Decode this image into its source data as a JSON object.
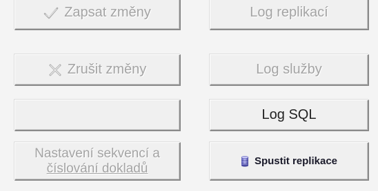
{
  "buttons": {
    "save": {
      "label": "Zapsat změny",
      "icon": "checkmark-icon",
      "enabled": false
    },
    "cancel": {
      "label": "Zrušit změny",
      "icon": "cross-icon",
      "enabled": false
    },
    "blank": {
      "label": ""
    },
    "sequences": {
      "line1": "Nastavení sekvencí a",
      "line2": "číslování dokladů",
      "enabled": false
    },
    "log_replication": {
      "label": "Log replikací",
      "enabled": false
    },
    "log_service": {
      "label": "Log služby",
      "enabled": false
    },
    "log_sql": {
      "label": "Log SQL",
      "enabled": true
    },
    "run_replication": {
      "label": "Spustit replikace",
      "icon": "database-icon",
      "enabled": true
    }
  },
  "colors": {
    "background": "#f4f4f4",
    "button_face": "#f0f0f0",
    "disabled_text": "#a4a4a4",
    "enabled_text": "#222222"
  }
}
